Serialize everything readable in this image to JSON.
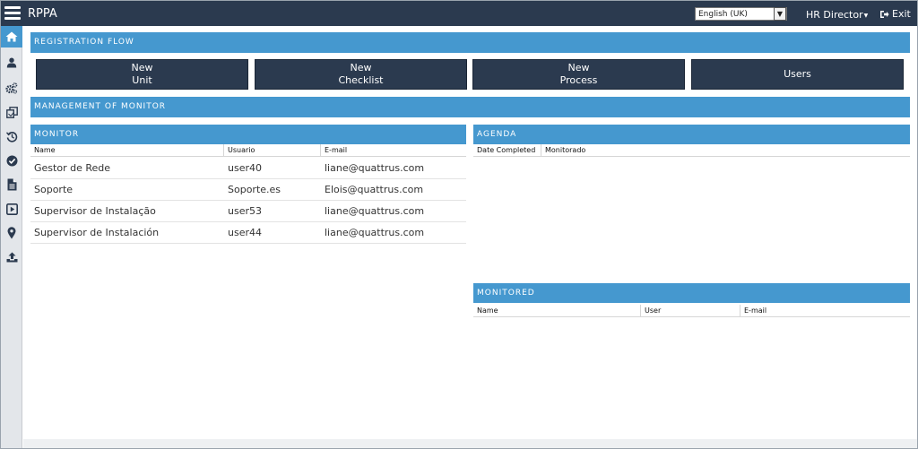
{
  "app": {
    "title": "RPPA"
  },
  "topbar": {
    "language": "English (UK)",
    "user": "HR Director",
    "exit_label": "Exit"
  },
  "sidebar": {
    "items": [
      {
        "icon": "home-icon",
        "active": true
      },
      {
        "icon": "user-icon"
      },
      {
        "icon": "gears-icon"
      },
      {
        "icon": "clone-icon"
      },
      {
        "icon": "history-icon"
      },
      {
        "icon": "check-circle-icon"
      },
      {
        "icon": "file-text-icon"
      },
      {
        "icon": "play-square-icon"
      },
      {
        "icon": "map-marker-icon"
      },
      {
        "icon": "upload-icon"
      }
    ]
  },
  "registration": {
    "title": "REGISTRATION FLOW",
    "buttons": [
      {
        "line1": "New",
        "line2": "Unit"
      },
      {
        "line1": "New",
        "line2": "Checklist"
      },
      {
        "line1": "New",
        "line2": "Process"
      },
      {
        "line1": "Users",
        "line2": ""
      }
    ]
  },
  "management": {
    "title": "MANAGEMENT OF MONITOR"
  },
  "monitor": {
    "title": "MONITOR",
    "columns": [
      "Name",
      "Usuario",
      "E-mail"
    ],
    "rows": [
      {
        "name": "Gestor de Rede",
        "user": "user40",
        "email": "liane@quattrus.com"
      },
      {
        "name": "Soporte",
        "user": "Soporte.es",
        "email": "Elois@quattrus.com"
      },
      {
        "name": "Supervisor de Instalação",
        "user": "user53",
        "email": "liane@quattrus.com"
      },
      {
        "name": "Supervisor de Instalación",
        "user": "user44",
        "email": "liane@quattrus.com"
      }
    ]
  },
  "agenda": {
    "title": "AGENDA",
    "columns": [
      "Date Completed",
      "Monitorado"
    ]
  },
  "monitored": {
    "title": "MONITORED",
    "columns": [
      "Name",
      "User",
      "E-mail"
    ]
  },
  "colors": {
    "topbar": "#2b3a4f",
    "accent": "#4598cf",
    "sidebar": "#e3e6ea"
  }
}
